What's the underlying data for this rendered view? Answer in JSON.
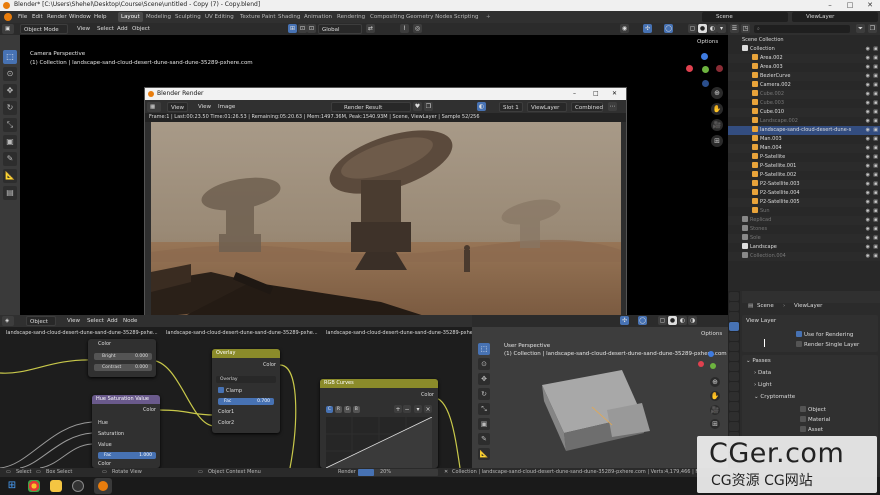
{
  "title_bar": {
    "title": "Blender* [C:\\Users\\Shehel\\Desktop\\Course\\Scene\\untitled - Copy (7) - Copy.blend]"
  },
  "top_menu": {
    "menus": [
      "File",
      "Edit",
      "Render",
      "Window",
      "Help"
    ],
    "workspaces": [
      "Layout",
      "Modeling",
      "Sculpting",
      "UV Editing",
      "Texture Paint",
      "Shading",
      "Animation",
      "Rendering",
      "Compositing",
      "Geometry Nodes",
      "Scripting"
    ],
    "active_workspace": "Layout",
    "scene": "Scene",
    "view_layer": "ViewLayer"
  },
  "viewport": {
    "mode": "Object Mode",
    "menus": [
      "View",
      "Select",
      "Add",
      "Object"
    ],
    "transform": "Global",
    "options": "Options",
    "perspective": "Camera Perspective",
    "collection_info": "(1) Collection | landscape-sand-cloud-desert-dune-sand-dune-35289-pxhere.com"
  },
  "render_window": {
    "title": "Blender Render",
    "menus": [
      "View",
      "View",
      "Image"
    ],
    "image_name": "Render Result",
    "slot": "Slot 1",
    "view_layer": "ViewLayer",
    "pass": "Combined",
    "stats": "Frame:1 | Last:00:23.50 Time:01:26.53 | Remaining:05:20.63 | Mem:1497.36M, Peak:1540.93M | Scene, ViewLayer | Sample 52/256"
  },
  "outliner": {
    "header": "Scene Collection",
    "items": [
      {
        "label": "Collection",
        "indent": 1,
        "color": "#dddddd",
        "selected": false,
        "dim": false
      },
      {
        "label": "Area.002",
        "indent": 2,
        "color": "#e8a33a",
        "selected": false,
        "dim": false
      },
      {
        "label": "Area.003",
        "indent": 2,
        "color": "#e8a33a",
        "selected": false,
        "dim": false
      },
      {
        "label": "BezierCurve",
        "indent": 2,
        "color": "#e8a33a",
        "selected": false,
        "dim": false
      },
      {
        "label": "Camera.002",
        "indent": 2,
        "color": "#e8a33a",
        "selected": false,
        "dim": false
      },
      {
        "label": "Cube.002",
        "indent": 2,
        "color": "#e8a33a",
        "selected": false,
        "dim": true
      },
      {
        "label": "Cube.003",
        "indent": 2,
        "color": "#e8a33a",
        "selected": false,
        "dim": true
      },
      {
        "label": "Cube.010",
        "indent": 2,
        "color": "#e8a33a",
        "selected": false,
        "dim": false
      },
      {
        "label": "Landscape.002",
        "indent": 2,
        "color": "#e8a33a",
        "selected": false,
        "dim": true
      },
      {
        "label": "landscape-sand-cloud-desert-dune-s",
        "indent": 2,
        "color": "#e8a33a",
        "selected": true,
        "dim": false
      },
      {
        "label": "Man.003",
        "indent": 2,
        "color": "#e8a33a",
        "selected": false,
        "dim": false
      },
      {
        "label": "Man.004",
        "indent": 2,
        "color": "#e8a33a",
        "selected": false,
        "dim": false
      },
      {
        "label": "P-Satellite",
        "indent": 2,
        "color": "#e8a33a",
        "selected": false,
        "dim": false
      },
      {
        "label": "P-Satellite.001",
        "indent": 2,
        "color": "#e8a33a",
        "selected": false,
        "dim": false
      },
      {
        "label": "P-Satellite.002",
        "indent": 2,
        "color": "#e8a33a",
        "selected": false,
        "dim": false
      },
      {
        "label": "P2-Satellite.003",
        "indent": 2,
        "color": "#e8a33a",
        "selected": false,
        "dim": false
      },
      {
        "label": "P2-Satellite.004",
        "indent": 2,
        "color": "#e8a33a",
        "selected": false,
        "dim": false
      },
      {
        "label": "P2-Satellite.005",
        "indent": 2,
        "color": "#e8a33a",
        "selected": false,
        "dim": false
      },
      {
        "label": "Sun",
        "indent": 2,
        "color": "#e8a33a",
        "selected": false,
        "dim": true
      },
      {
        "label": "Replicad",
        "indent": 1,
        "color": "#888888",
        "selected": false,
        "dim": true
      },
      {
        "label": "Stones",
        "indent": 1,
        "color": "#888888",
        "selected": false,
        "dim": true
      },
      {
        "label": "Sole",
        "indent": 1,
        "color": "#888888",
        "selected": false,
        "dim": true
      },
      {
        "label": "Landscape",
        "indent": 1,
        "color": "#dddddd",
        "selected": false,
        "dim": false
      },
      {
        "label": "Collection.004",
        "indent": 1,
        "color": "#888888",
        "selected": false,
        "dim": true
      }
    ]
  },
  "properties": {
    "breadcrumb_scene": "Scene",
    "breadcrumb_layer": "ViewLayer",
    "panel_title": "View Layer",
    "use_for_rendering": "Use for Rendering",
    "render_single_layer": "Render Single Layer",
    "passes": "Passes",
    "data": "Data",
    "light": "Light",
    "cryptomatte": "Cryptomatte",
    "crypto_items": [
      "Object",
      "Material",
      "Asset"
    ]
  },
  "node_editor": {
    "mode": "Object",
    "menus": [
      "View",
      "Select",
      "Add",
      "Node"
    ],
    "image_tabs": [
      "landscape-sand-cloud-desert-dune-sand-dune-35289-pxhe...",
      "landscape-sand-cloud-desert-dune-sand-dune-35289-pxhe...",
      "landscape-sand-cloud-desert-dune-sand-dune-35289-pxhe..."
    ],
    "node_color": {
      "color": "Color",
      "bright_label": "Bright",
      "bright_value": "0.000",
      "contrast_label": "Contrast",
      "contrast_value": "0.000"
    },
    "node_hue": {
      "title": "Hue Saturation Value",
      "out": "Color",
      "hue": "Hue",
      "saturation": "Saturation",
      "value": "Value",
      "fac": "Fac",
      "fac_value": "1.000",
      "color": "Color"
    },
    "node_overlay": {
      "title": "Overlay",
      "out": "Color",
      "blend": "Overlay",
      "clamp": "Clamp",
      "fac": "Fac",
      "fac_value": "0.700",
      "color1": "Color1",
      "color2": "Color2"
    },
    "node_rgb": {
      "title": "RGB Curves",
      "out": "Color",
      "channels": [
        "C",
        "R",
        "G",
        "B"
      ]
    }
  },
  "viewport_bottom": {
    "perspective": "User Perspective",
    "collection_info": "(1) Collection | landscape-sand-cloud-desert-dune-sand-dune-35289-pxhere.com",
    "options": "Options"
  },
  "status_bar": {
    "select": "Select",
    "box_select": "Box Select",
    "rotate_view": "Rotate View",
    "context_menu": "Object Context Menu",
    "render_label": "Render",
    "render_percent": "20%",
    "stats": "Collection | landscape-sand-cloud-desert-dune-sand-dune-35289-pxhere.com | Verts:4,179,466 | Faces:5,026,860 |"
  },
  "watermark": {
    "big": "CGer.com",
    "small": "CG资源 CG网站"
  },
  "colors": {
    "accent": "#4772b3",
    "blender_orange": "#e87d0d",
    "node_header_yellow": "#8b8b2a",
    "node_header_purple": "#5a4a8c"
  }
}
